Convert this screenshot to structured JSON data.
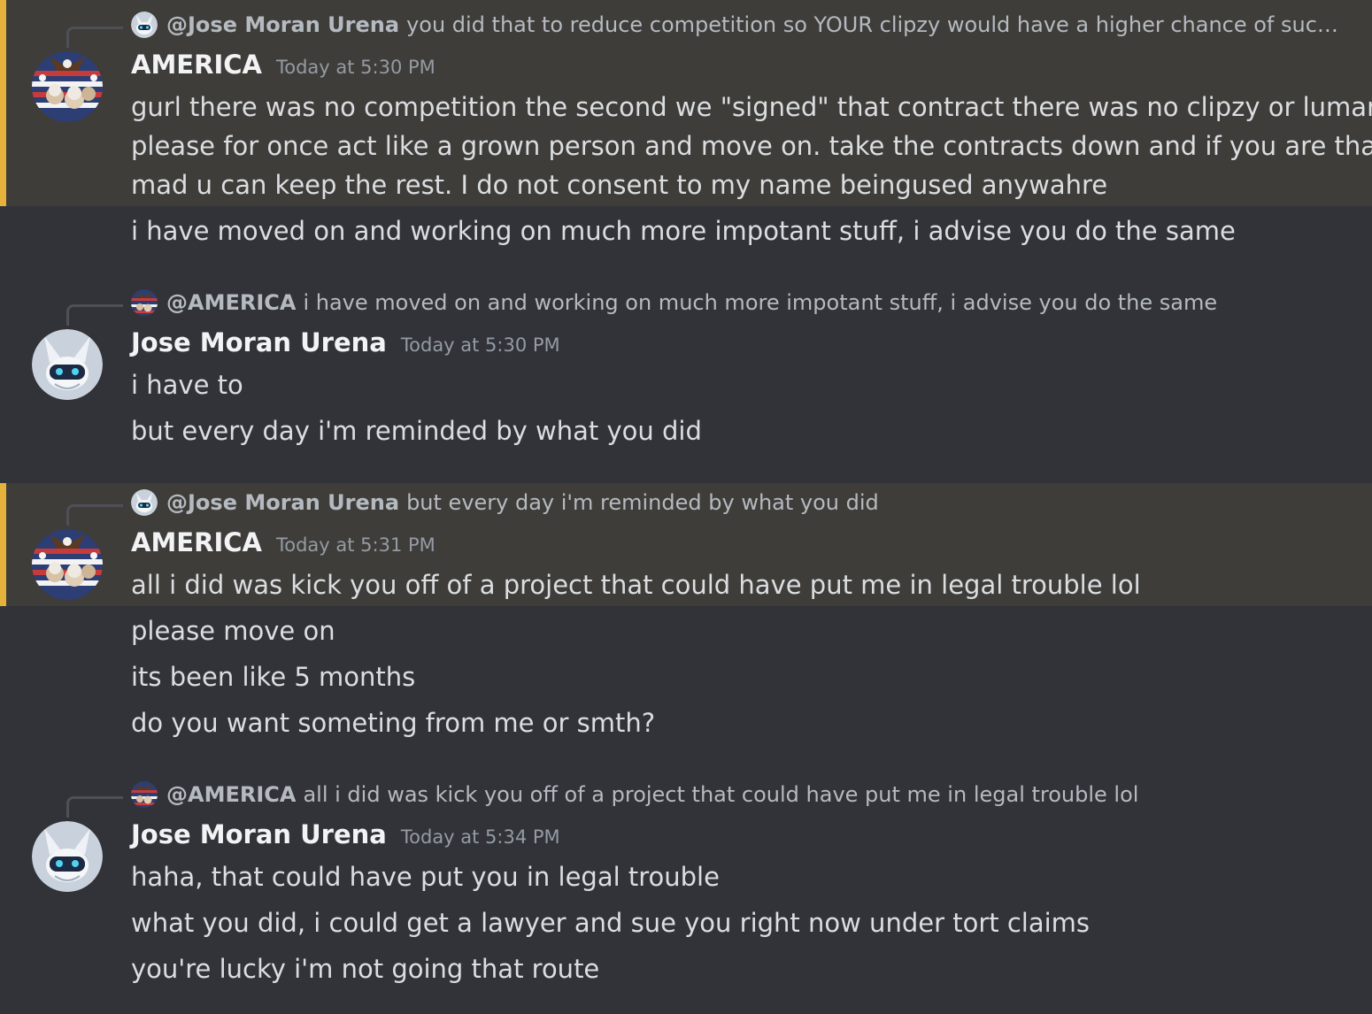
{
  "messages": [
    {
      "reply": {
        "name": "@Jose Moran Urena",
        "text": "you did that to reduce competition so YOUR clipzy would have a higher chance of succee..."
      },
      "author": "AMERICA",
      "timestamp": "Today at 5:30 PM",
      "lines": [
        "gurl there was no competition the second we \"signed\" that contract there was no clipzy or luman,",
        "please for once act like a grown person and move on. take the contracts down and if you are that",
        "mad u can keep the rest. I do not consent to my name beingused anywahre"
      ],
      "followups": [
        "i have moved on and working on much more impotant stuff, i advise you do the same"
      ]
    },
    {
      "reply": {
        "name": "@AMERICA",
        "text": "i have moved on and working on much more impotant stuff, i advise you do the same"
      },
      "author": "Jose Moran Urena",
      "timestamp": "Today at 5:30 PM",
      "lines": [
        "i have to"
      ],
      "followups": [
        "but every day i'm reminded by what you did"
      ]
    },
    {
      "reply": {
        "name": "@Jose Moran Urena",
        "text": "but every day i'm reminded by what you did"
      },
      "author": "AMERICA",
      "timestamp": "Today at 5:31 PM",
      "lines": [
        "all i did was kick you off of a project that could have put me in legal trouble lol"
      ],
      "followups": [
        "please move on",
        "its been like 5 months",
        "do you want someting from me or smth?"
      ]
    },
    {
      "reply": {
        "name": "@AMERICA",
        "text": "all i did was kick you off of a project that could have put me in legal trouble lol"
      },
      "author": "Jose Moran Urena",
      "timestamp": "Today at 5:34 PM",
      "lines": [
        "haha, that could have put you in legal trouble"
      ],
      "followups": [
        "what you did, i could get a lawyer and sue you right now under tort claims",
        "you're lucky i'm not going that route"
      ]
    }
  ],
  "colors": {
    "background": "#313338",
    "mention_highlight": "#3f3d39",
    "mention_bar": "#e5b23c",
    "author": "#f2f3f5",
    "text": "#dbdee1",
    "muted": "#949ba4"
  },
  "icons": {
    "america_avatar": "patriotic-collage-avatar-icon",
    "jose_avatar": "blue-fox-protogen-avatar-icon"
  }
}
